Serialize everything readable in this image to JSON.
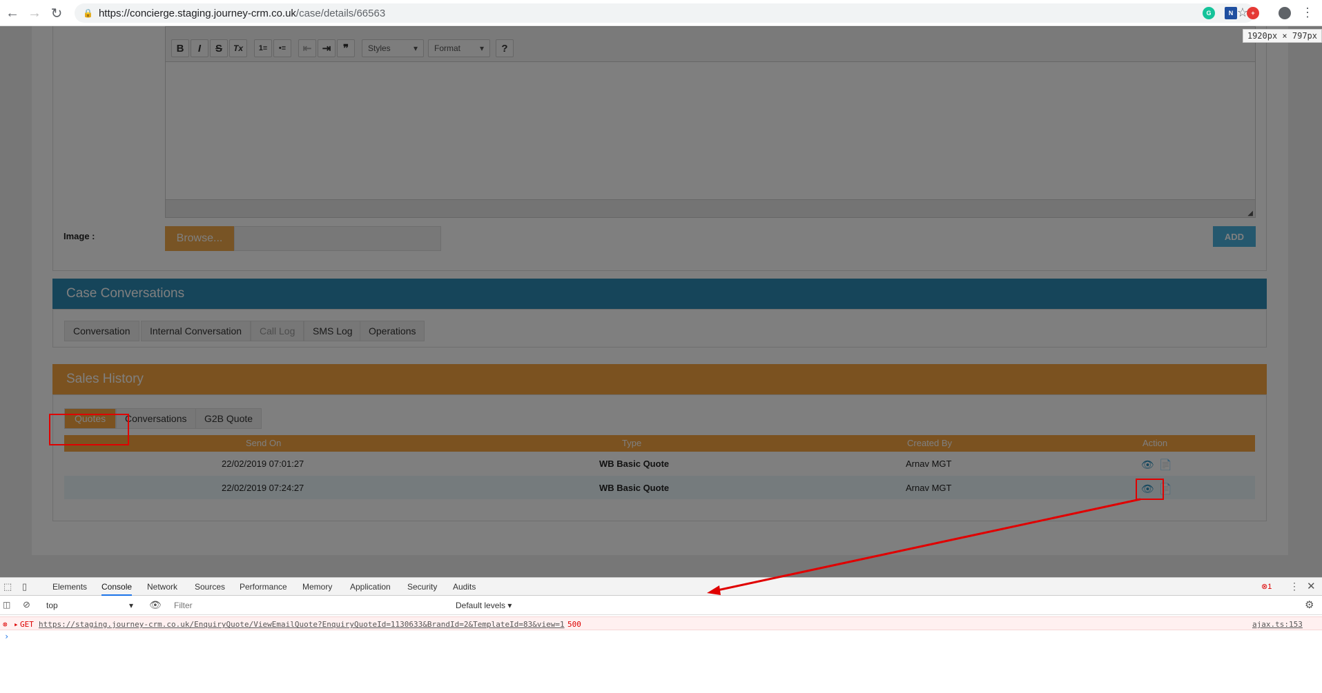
{
  "browser": {
    "url_host": "https://concierge.staging.journey-crm.co.uk",
    "url_path": "/case/details/66563",
    "dimension_tooltip": "1920px × 797px"
  },
  "editor": {
    "styles_label": "Styles",
    "format_label": "Format",
    "buttons": [
      "B",
      "I",
      "S",
      "Tx",
      "1≡",
      "•≡",
      "⇤",
      "⇥",
      "❞",
      "?"
    ]
  },
  "image_row": {
    "label": "Image :",
    "browse_label": "Browse...",
    "add_label": "ADD"
  },
  "case_conversations": {
    "title": "Case Conversations",
    "header_color": "#2c8ab5",
    "tabs": [
      "Conversation",
      "Internal Conversation",
      "Call Log",
      "SMS Log",
      "Operations"
    ]
  },
  "sales_history": {
    "title": "Sales History",
    "header_color": "#f7a541",
    "tabs": [
      "Quotes",
      "Conversations",
      "G2B Quote"
    ],
    "columns": [
      "Send On",
      "Type",
      "Created By",
      "Action"
    ],
    "rows": [
      {
        "send_on": "22/02/2019 07:01:27",
        "type": "WB Basic Quote",
        "created_by": "Arnav MGT"
      },
      {
        "send_on": "22/02/2019 07:24:27",
        "type": "WB Basic Quote",
        "created_by": "Arnav MGT"
      }
    ]
  },
  "devtools": {
    "tabs": [
      "Elements",
      "Console",
      "Network",
      "Sources",
      "Performance",
      "Memory",
      "Application",
      "Security",
      "Audits"
    ],
    "active_tab": "Console",
    "error_count": "1",
    "context": "top",
    "filter_placeholder": "Filter",
    "levels": "Default levels ▾",
    "error": {
      "method": "GET",
      "url": "https://staging.journey-crm.co.uk/EnquiryQuote/ViewEmailQuote?EnquiryQuoteId=1130633&BrandId=2&TemplateId=83&view=1",
      "status": "500",
      "source": "ajax.ts:153"
    }
  }
}
